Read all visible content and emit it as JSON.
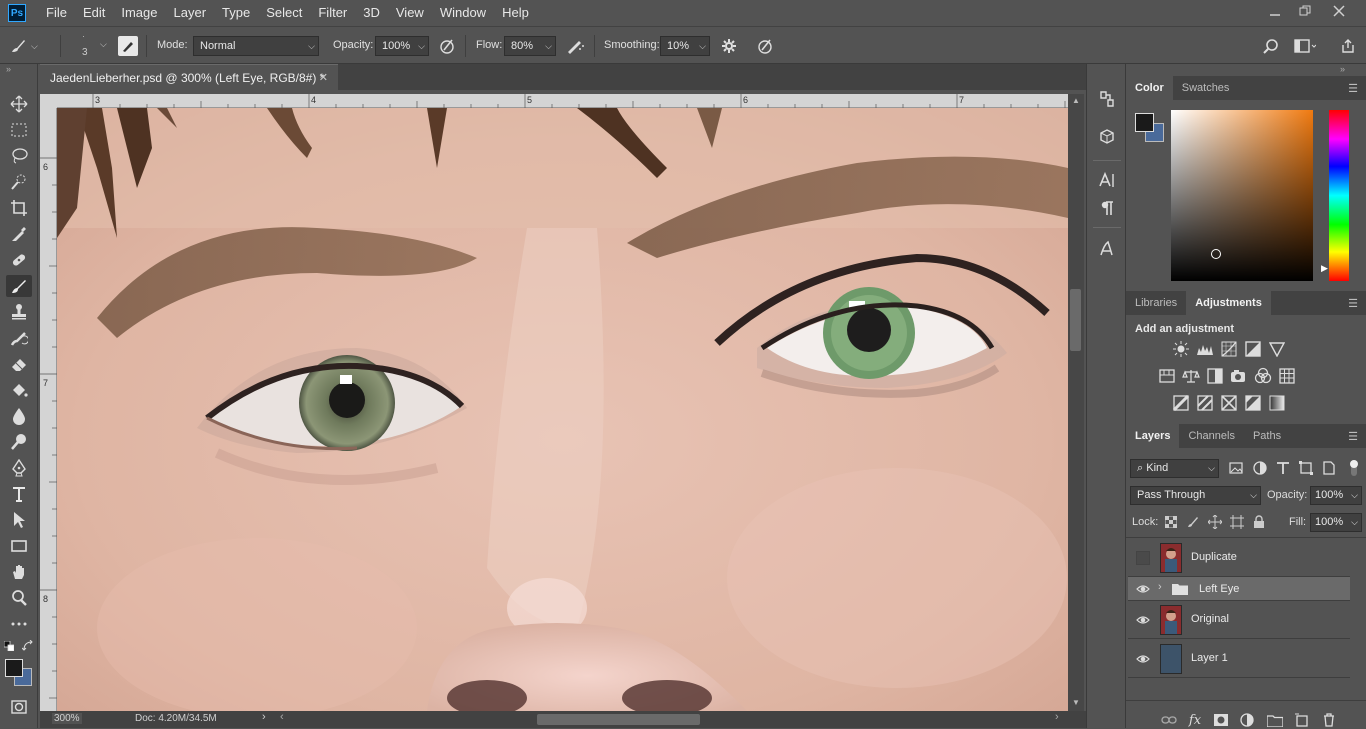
{
  "app": {
    "logo": "Ps"
  },
  "menu": [
    "File",
    "Edit",
    "Image",
    "Layer",
    "Type",
    "Select",
    "Filter",
    "3D",
    "View",
    "Window",
    "Help"
  ],
  "options": {
    "brush_size": "3",
    "mode_label": "Mode:",
    "mode_value": "Normal",
    "opacity_label": "Opacity:",
    "opacity_value": "100%",
    "flow_label": "Flow:",
    "flow_value": "80%",
    "smoothing_label": "Smoothing:",
    "smoothing_value": "10%"
  },
  "document": {
    "tab_title": "JaedenLieberher.psd @ 300% (Left Eye, RGB/8#) *",
    "ruler_top": [
      "3",
      "4",
      "5",
      "6",
      "7"
    ],
    "ruler_left": [
      "6",
      "7",
      "8"
    ],
    "zoom": "300%",
    "doc_info": "Doc: 4.20M/34.5M"
  },
  "color_panel": {
    "tabs": [
      "Color",
      "Swatches"
    ],
    "fg_color": "#1a1a1a",
    "bg_color": "#4a6a9a",
    "hue_color": "#f07a10"
  },
  "adjust_panel": {
    "tabs": [
      "Libraries",
      "Adjustments"
    ],
    "heading": "Add an adjustment"
  },
  "layers_panel": {
    "tabs": [
      "Layers",
      "Channels",
      "Paths"
    ],
    "filter_label": "Kind",
    "blend_mode": "Pass Through",
    "opacity_label": "Opacity:",
    "opacity_value": "100%",
    "lock_label": "Lock:",
    "fill_label": "Fill:",
    "fill_value": "100%",
    "layers": [
      {
        "name": "Duplicate",
        "visible": false,
        "type": "image"
      },
      {
        "name": "Left Eye",
        "visible": true,
        "type": "group",
        "selected": true
      },
      {
        "name": "Original",
        "visible": true,
        "type": "image"
      },
      {
        "name": "Layer 1",
        "visible": true,
        "type": "fill"
      }
    ]
  }
}
